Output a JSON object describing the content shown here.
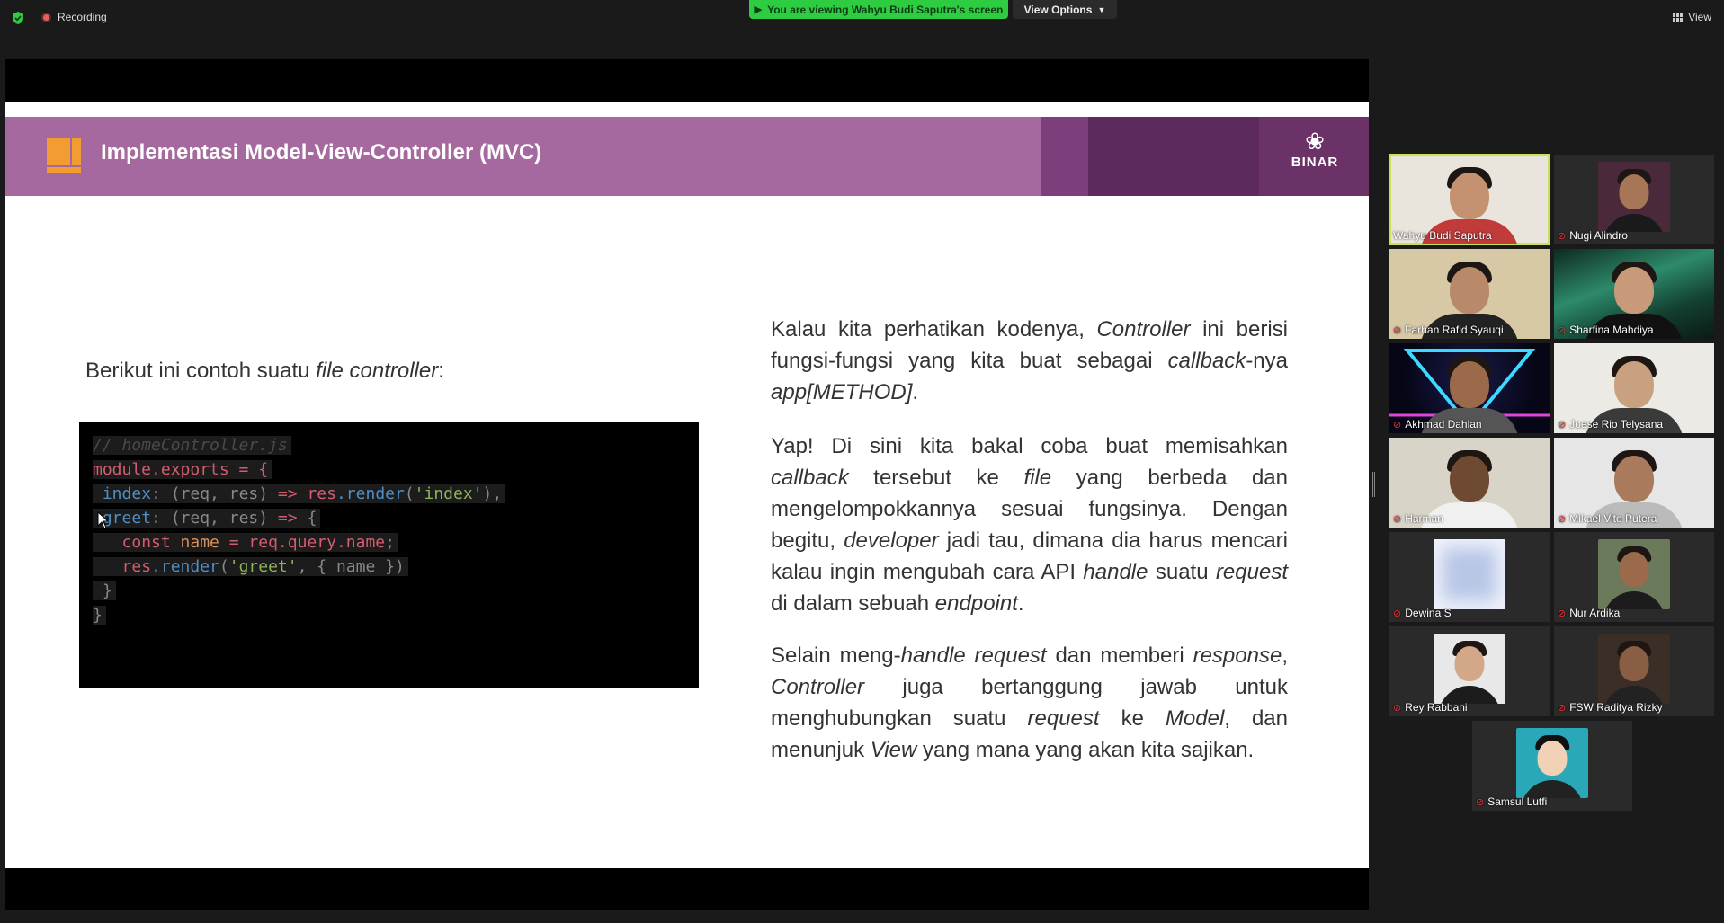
{
  "topbar": {
    "recording_label": "Recording",
    "viewing_label": "You are viewing Wahyu Budi Saputra's screen",
    "view_options_label": "View Options",
    "view_label": "View"
  },
  "colors": {
    "viewing_banner": "#2ecc40",
    "slide_banner": "#a6699f",
    "accent_orange": "#f39c32",
    "active_speaker_outline": "#c8e05a",
    "muted_mic": "#e0353a"
  },
  "slide": {
    "title": "Implementasi Model-View-Controller (MVC)",
    "logo_text": "BINAR",
    "intro": {
      "pre": "Berikut ini contoh suatu ",
      "em": "file controller",
      "post": ":"
    },
    "code": {
      "comment": "// homeController.js",
      "line2_kw": "module.exports",
      "line2_rest": " = {",
      "index_prop": "index",
      "index_mid": ": (req, res) ",
      "arrow": "=>",
      "res": "res",
      "render": ".render",
      "index_str": "'index'",
      "index_end": "),",
      "greet_prop": "greet",
      "greet_rest": ": (req, res) ",
      "greet_open": " {",
      "const_kw": "const",
      "name_var": "name",
      "eq": " = ",
      "req_query": "req.query.name",
      "semi": ";",
      "greet_str": "'greet'",
      "greet_args": ", { name })",
      "close_inner": "}",
      "close_outer": "}"
    },
    "para1": [
      {
        "t": "Kalau kita perhatikan kodenya, "
      },
      {
        "t": "Controller",
        "i": true
      },
      {
        "t": " ini berisi fungsi-fungsi yang kita buat sebagai "
      },
      {
        "t": "callback",
        "i": true
      },
      {
        "t": "-nya "
      },
      {
        "t": "app[METHOD]",
        "i": true
      },
      {
        "t": "."
      }
    ],
    "para2": [
      {
        "t": "Yap! Di sini kita  bakal coba buat memisahkan "
      },
      {
        "t": "callback",
        "i": true
      },
      {
        "t": " tersebut ke "
      },
      {
        "t": "file",
        "i": true
      },
      {
        "t": " yang berbeda dan mengelompokkannya sesuai fungsinya. Dengan begitu, "
      },
      {
        "t": "developer",
        "i": true
      },
      {
        "t": " jadi tau, dimana dia harus mencari kalau ingin mengubah cara API "
      },
      {
        "t": "handle",
        "i": true
      },
      {
        "t": " suatu "
      },
      {
        "t": "request",
        "i": true
      },
      {
        "t": " di dalam sebuah "
      },
      {
        "t": "endpoint",
        "i": true
      },
      {
        "t": "."
      }
    ],
    "para3": [
      {
        "t": "Selain meng-"
      },
      {
        "t": "handle request",
        "i": true
      },
      {
        "t": " dan memberi "
      },
      {
        "t": "response",
        "i": true
      },
      {
        "t": ", "
      },
      {
        "t": "Controller",
        "i": true
      },
      {
        "t": " juga bertanggung jawab untuk menghubungkan suatu "
      },
      {
        "t": "request",
        "i": true
      },
      {
        "t": " ke "
      },
      {
        "t": "Model",
        "i": true
      },
      {
        "t": ", dan menunjuk "
      },
      {
        "t": "View",
        "i": true
      },
      {
        "t": " yang mana yang akan kita sajikan."
      }
    ]
  },
  "participants": [
    {
      "name": "Wahyu Budi Saputra",
      "muted": false,
      "active": true,
      "icon": "video-person"
    },
    {
      "name": "Nugi Alindro",
      "muted": true,
      "active": false,
      "icon": "video-person"
    },
    {
      "name": "Farhan Rafid Syauqi",
      "muted": true,
      "active": false,
      "icon": "video-person"
    },
    {
      "name": "Sharfina Mahdiya",
      "muted": true,
      "active": false,
      "icon": "aurora-background"
    },
    {
      "name": "Akhmad Dahlan",
      "muted": true,
      "active": false,
      "icon": "neon-background"
    },
    {
      "name": "Joese Rio Telysana",
      "muted": true,
      "active": false,
      "icon": "video-person"
    },
    {
      "name": "Harman",
      "muted": true,
      "active": false,
      "icon": "video-person"
    },
    {
      "name": "Mikael Vito Putera",
      "muted": true,
      "active": false,
      "icon": "video-person"
    },
    {
      "name": "Dewina S",
      "muted": true,
      "active": false,
      "icon": "blurred-avatar"
    },
    {
      "name": "Nur Ardika",
      "muted": true,
      "active": false,
      "icon": "photo-avatar"
    },
    {
      "name": "Rey Rabbani",
      "muted": true,
      "active": false,
      "icon": "photo-avatar"
    },
    {
      "name": "FSW Raditya Rizky",
      "muted": true,
      "active": false,
      "icon": "photo-avatar"
    },
    {
      "name": "Samsul Lutfi",
      "muted": true,
      "active": false,
      "icon": "cartoon-avatar"
    }
  ]
}
